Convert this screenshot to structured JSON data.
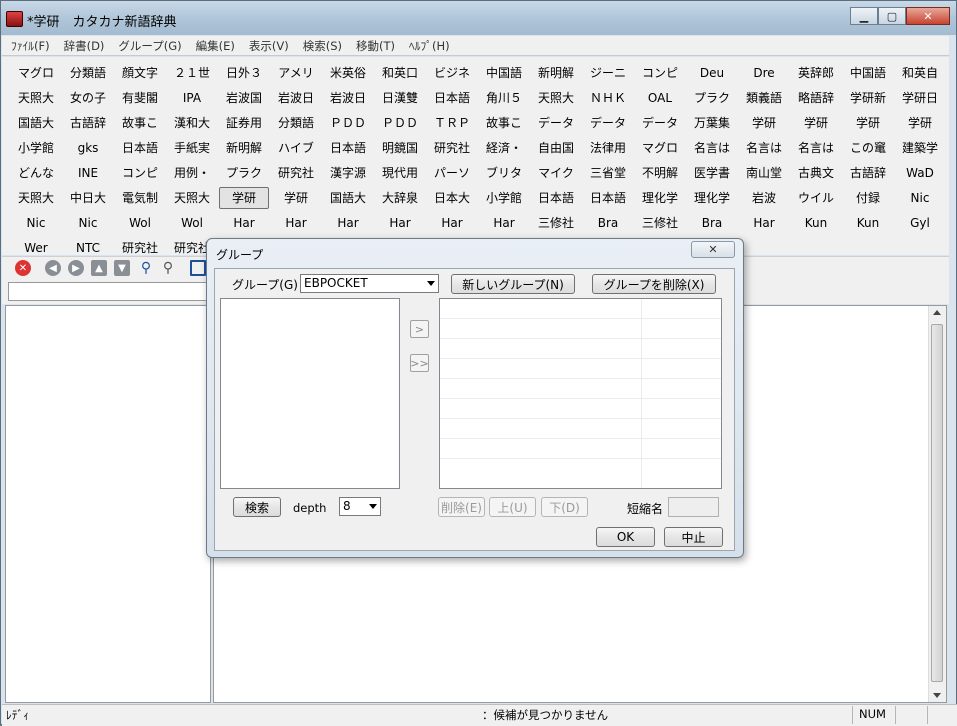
{
  "window": {
    "title": "*学研　カタカナ新語辞典"
  },
  "menu": [
    "ﾌｧｲﾙ(F)",
    "辞書(D)",
    "グループ(G)",
    "編集(E)",
    "表示(V)",
    "検索(S)",
    "移動(T)",
    "ﾍﾙﾌﾟ(H)"
  ],
  "dictionaries": [
    [
      "マグロ",
      "分類語",
      "顔文字",
      "２１世",
      "日外３",
      "アメリ",
      "米英俗",
      "和英口",
      "ビジネ",
      "中国語",
      "新明解",
      "ジーニ",
      "コンピ",
      "Deu",
      "Dre",
      "英辞郎",
      "中国語",
      "和英自"
    ],
    [
      "天照大",
      "女の子",
      "有斐閣",
      "IPA",
      "岩波国",
      "岩波日",
      "岩波日",
      "日漢雙",
      "日本語",
      "角川５",
      "天照大",
      "ＮＨＫ",
      "OAL",
      "プラク",
      "類義語",
      "略語辞",
      "学研新",
      "学研日"
    ],
    [
      "国語大",
      "古語辞",
      "故事こ",
      "漢和大",
      "証券用",
      "分類語",
      "ＰＤＤ",
      "ＰＤＤ",
      "ＴＲＰ",
      "故事こ",
      "データ",
      "データ",
      "データ",
      "万葉集",
      "学研",
      "学研",
      "学研",
      "学研"
    ],
    [
      "小学館",
      "gks",
      "日本語",
      "手紙実",
      "新明解",
      "ハイブ",
      "日本語",
      "明鏡国",
      "研究社",
      "経済・",
      "自由国",
      "法律用",
      "マグロ",
      "名言は",
      "名言は",
      "名言は",
      "この竃",
      "建築学"
    ],
    [
      "どんな",
      "INE",
      "コンピ",
      "用例・",
      "プラク",
      "研究社",
      "漢字源",
      "現代用",
      "パーソ",
      "ブリタ",
      "マイク",
      "三省堂",
      "不明解",
      "医学書",
      "南山堂",
      "古典文",
      "古語辞",
      "WaD"
    ],
    [
      "天照大",
      "中日大",
      "電気制",
      "天照大",
      "学研",
      "学研",
      "国語大",
      "大辞泉",
      "日本大",
      "小学館",
      "日本語",
      "日本語",
      "理化学",
      "理化学",
      "岩波",
      "ウイル",
      "付録",
      "Nic"
    ],
    [
      "Nic",
      "Nic",
      "Wol",
      "Wol",
      "Har",
      "Har",
      "Har",
      "Har",
      "Har",
      "Har",
      "三修社",
      "Bra",
      "三修社",
      "Bra",
      "Har",
      "Kun",
      "Kun",
      "Gyl"
    ],
    [
      "Wer",
      "NTC",
      "研究社",
      "研究社",
      "",
      "",
      "",
      "",
      "",
      "",
      "",
      "",
      "",
      "",
      "",
      "",
      "",
      ""
    ]
  ],
  "selected_dictionary": "学研",
  "dialog": {
    "title": "グループ",
    "group_label": "グループ(G)",
    "group_value": "EBPOCKET",
    "new_group_button": "新しいグループ(N)",
    "delete_group_button": "グループを削除(X)",
    "add_button": ">",
    "add_all_button": ">>",
    "search_button": "検索",
    "depth_label": "depth",
    "depth_value": "8",
    "remove_button": "削除(E)",
    "up_button": "上(U)",
    "down_button": "下(D)",
    "short_name_label": "短縮名",
    "ok_button": "OK",
    "cancel_button": "中止"
  },
  "status": {
    "left": "ﾚﾃﾞｨ",
    "message": "：候補が見つかりません",
    "num": "NUM"
  }
}
